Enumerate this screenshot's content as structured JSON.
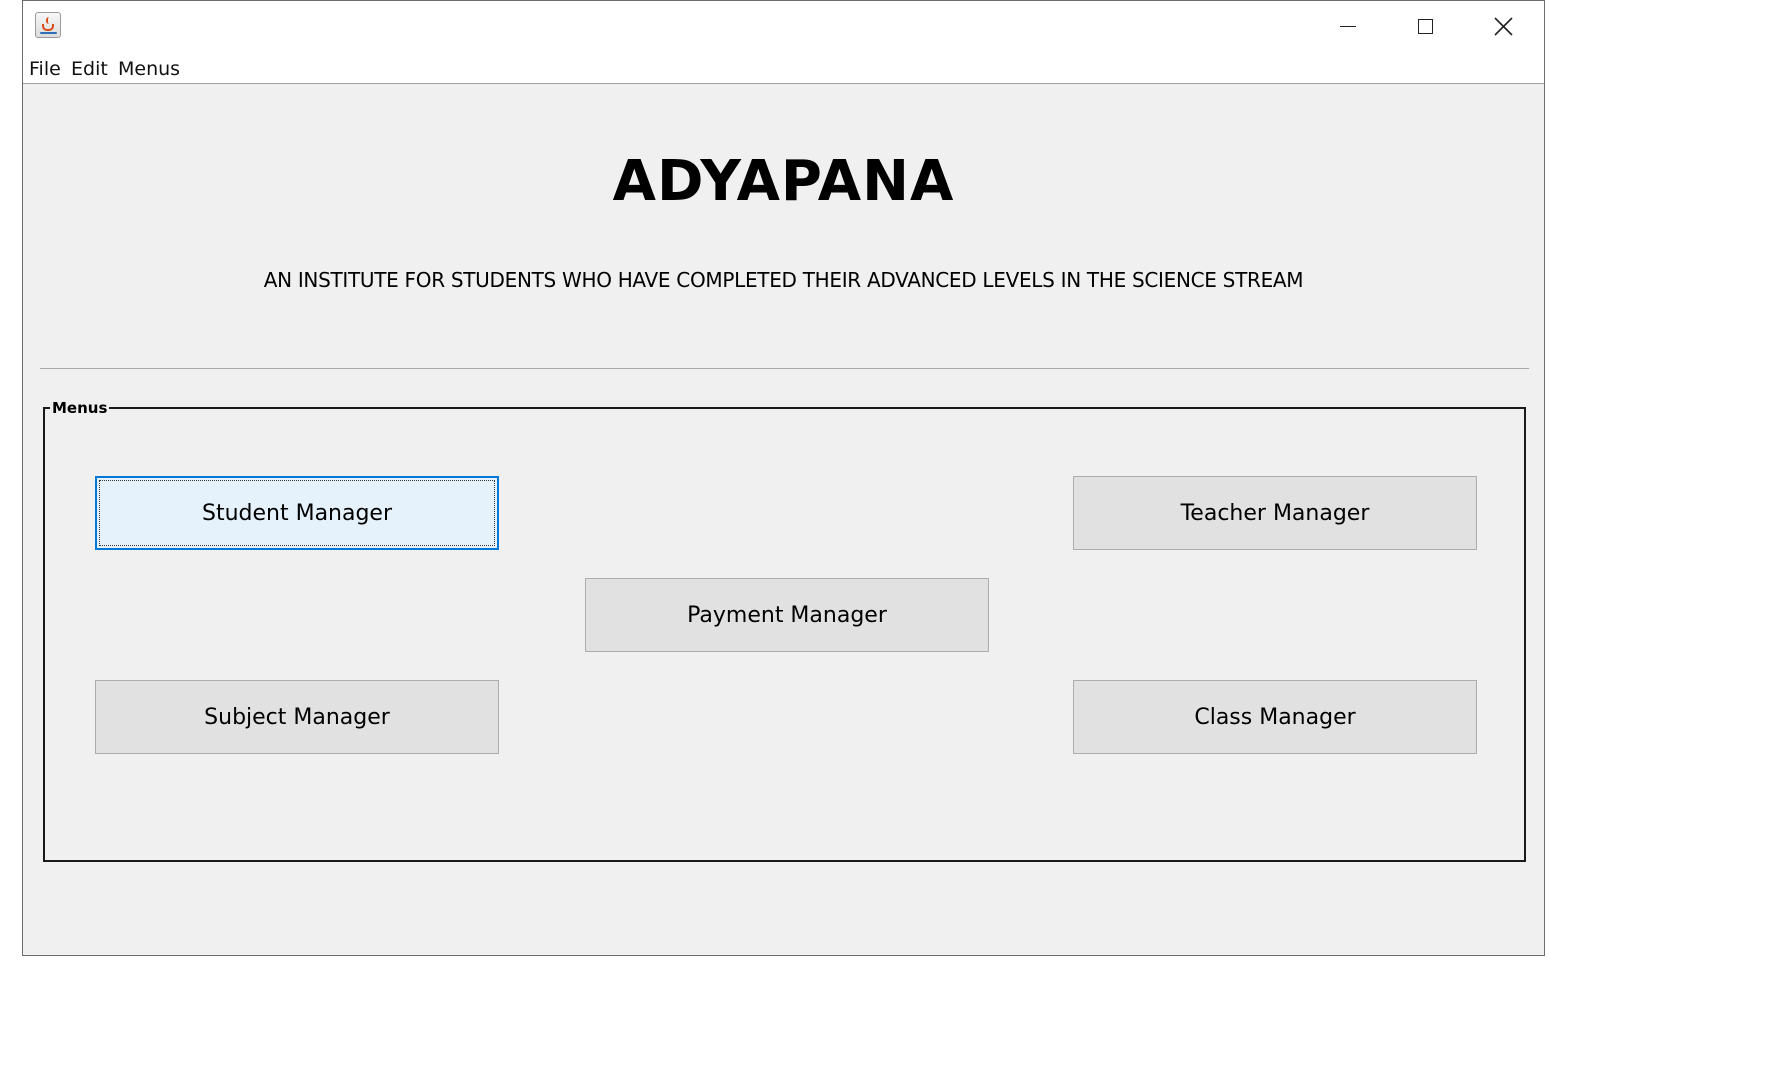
{
  "window": {
    "app_icon": "java-cup-icon",
    "controls": {
      "minimize": "minimize-icon",
      "maximize": "maximize-icon",
      "close": "close-icon"
    }
  },
  "menubar": {
    "items": [
      {
        "label": "File"
      },
      {
        "label": "Edit"
      },
      {
        "label": "Menus"
      }
    ]
  },
  "header": {
    "title": "ADYAPANA",
    "subtitle": "AN INSTITUTE FOR STUDENTS WHO HAVE COMPLETED THEIR ADVANCED LEVELS IN THE SCIENCE STREAM"
  },
  "menus_panel": {
    "legend": "Menus",
    "buttons": {
      "student": "Student Manager",
      "teacher": "Teacher Manager",
      "payment": "Payment Manager",
      "subject": "Subject Manager",
      "class": "Class Manager"
    },
    "focused": "student"
  },
  "colors": {
    "window_bg": "#f0f0f0",
    "button_bg": "#e1e1e1",
    "focus_border": "#0078d7",
    "focus_bg": "#e5f1fb"
  }
}
